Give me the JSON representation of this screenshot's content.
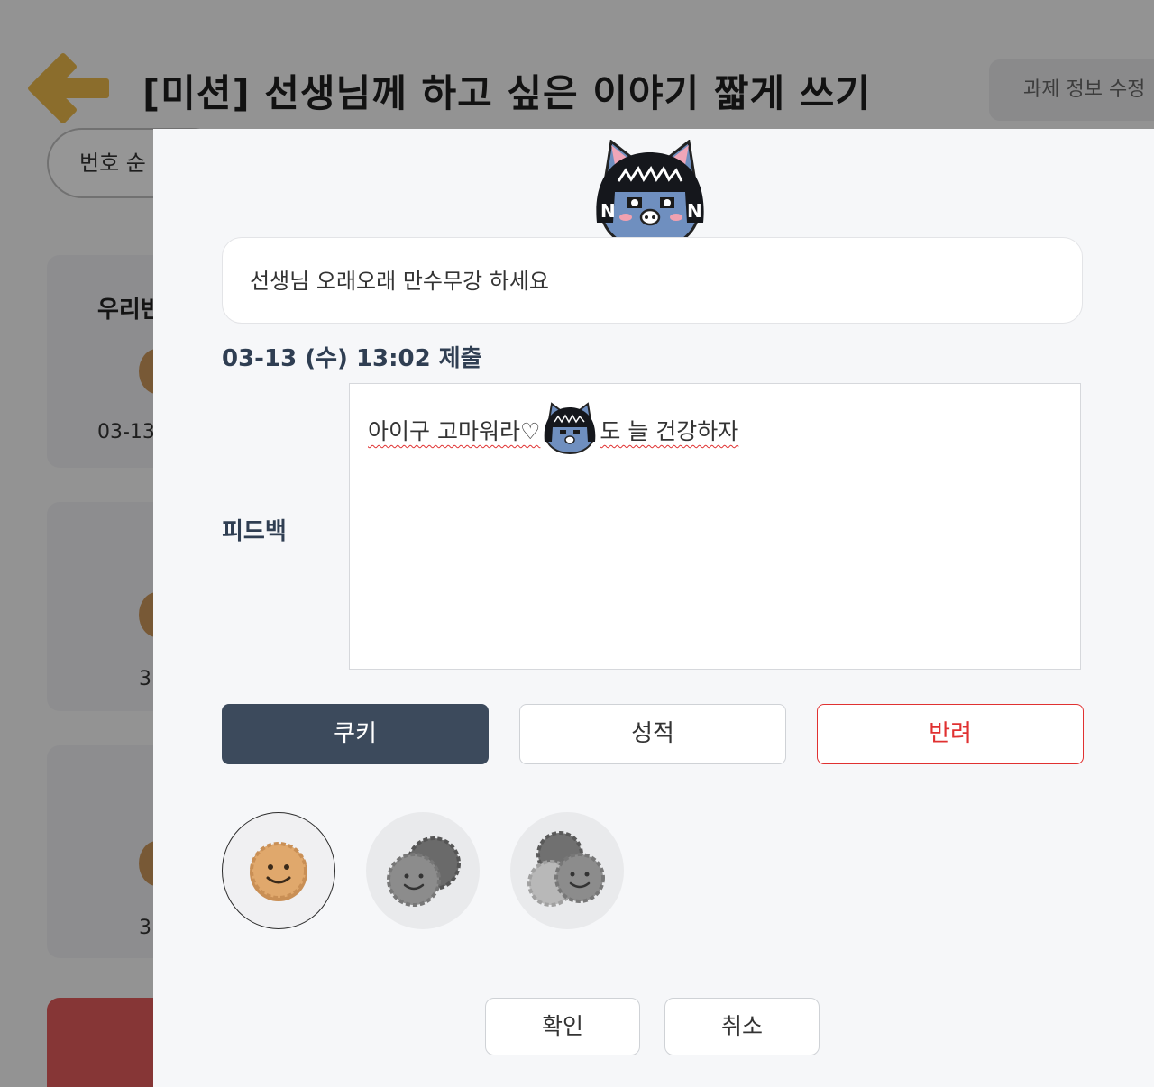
{
  "page": {
    "title": "[미션] 선생님께 하고 싶은 이야기 짧게 쓰기",
    "edit_info_button": "과제 정보 수정",
    "sort_label": "번호 순",
    "back_icon": "arrow-left-icon",
    "cards": [
      {
        "name": "우리반",
        "date": "03-13"
      },
      {
        "name": "",
        "date": "3"
      },
      {
        "name": "",
        "date": "3"
      },
      {
        "name": "",
        "date": ""
      }
    ]
  },
  "modal": {
    "avatar_icon": "neo-cat-character-icon",
    "message": "선생님 오래오래 만수무강 하세요",
    "submitted_at": "03-13 (수) 13:02 제출",
    "feedback_label": "피드백",
    "feedback": {
      "before_emoji": "아이구 고마워라♡ ",
      "after_emoji": "도 늘 건강하자",
      "emoji_icon": "neo-cat-emoticon-icon"
    },
    "tabs": [
      {
        "label": "쿠키",
        "active": true
      },
      {
        "label": "성적",
        "active": false
      },
      {
        "label": "반려",
        "active": false
      }
    ],
    "cookie_options": [
      {
        "count": 1,
        "selected": true
      },
      {
        "count": 2,
        "selected": false
      },
      {
        "count": 3,
        "selected": false
      }
    ],
    "confirm_label": "확인",
    "cancel_label": "취소"
  },
  "colors": {
    "primary_dark": "#3c4a5c",
    "reject_red": "#e03131",
    "cookie_orange": "#d9a66a",
    "arrow_gold": "#e8b64a"
  }
}
